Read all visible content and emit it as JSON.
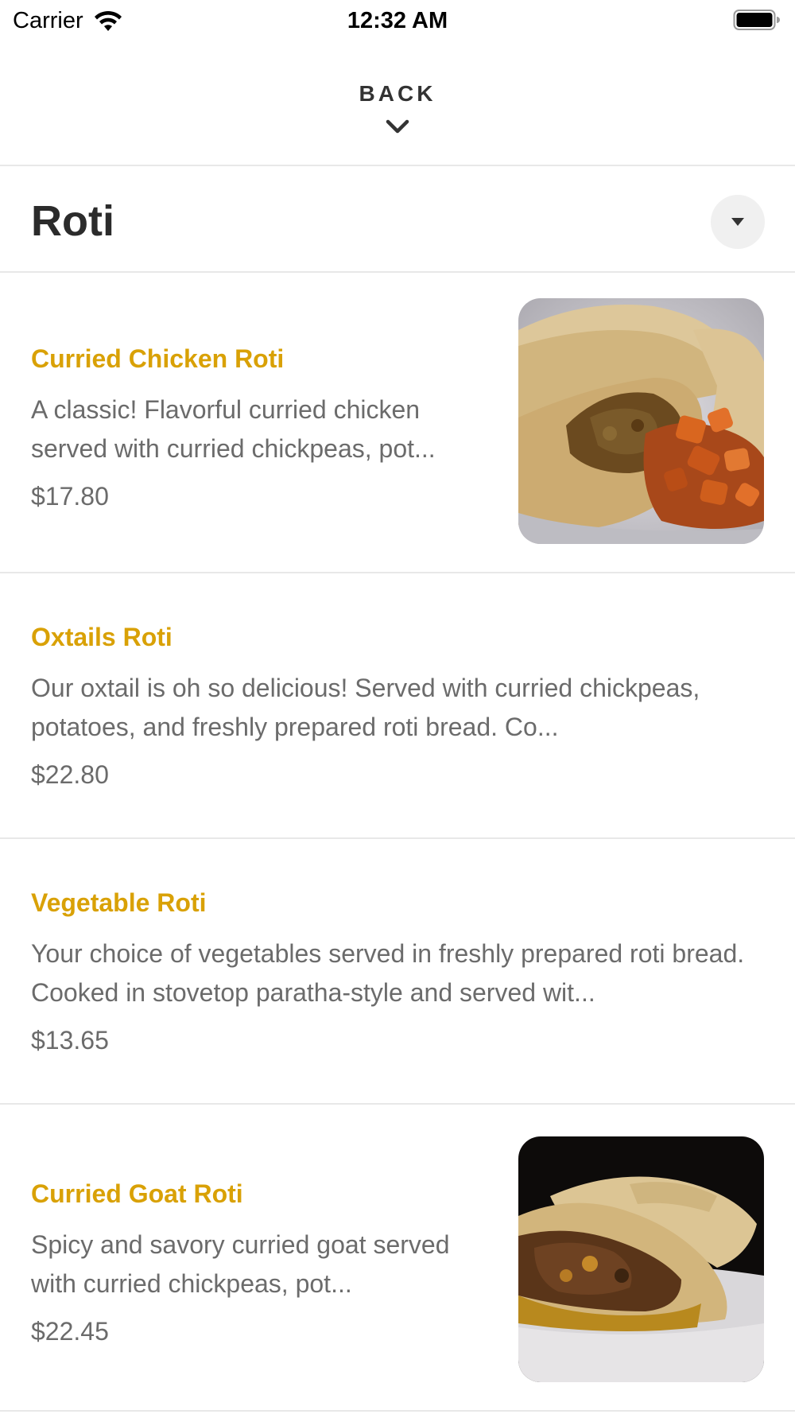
{
  "status_bar": {
    "carrier": "Carrier",
    "time": "12:32 AM"
  },
  "header": {
    "back_label": "BACK"
  },
  "category": {
    "title": "Roti"
  },
  "menu_items": [
    {
      "name": "Curried Chicken Roti",
      "description": "A classic! Flavorful curried chicken served with curried chickpeas, pot...",
      "price": "$17.80"
    },
    {
      "name": "Oxtails Roti",
      "description": "Our oxtail is oh so delicious! Served with curried chickpeas, potatoes, and freshly prepared roti bread. Co...",
      "price": "$22.80"
    },
    {
      "name": "Vegetable Roti",
      "description": "Your choice of vegetables served in freshly prepared roti bread. Cooked in stovetop paratha-style and served wit...",
      "price": "$13.65"
    },
    {
      "name": "Curried Goat Roti",
      "description": "Spicy and savory curried goat served with curried chickpeas, pot...",
      "price": "$22.45"
    }
  ],
  "colors": {
    "item_name": "#d9a106",
    "item_text": "#6b6b6b",
    "title": "#2b2b2b",
    "divider": "#e8e8e8"
  }
}
